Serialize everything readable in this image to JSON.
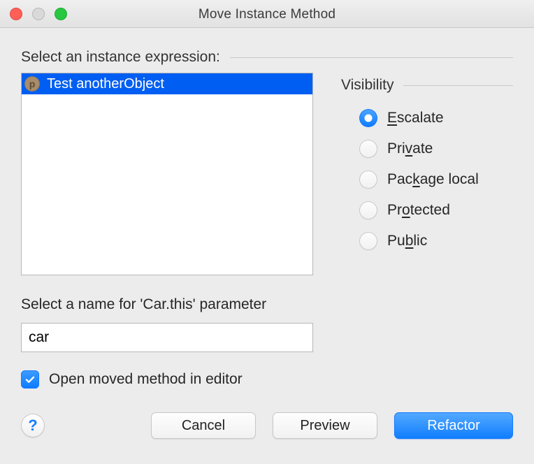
{
  "window": {
    "title": "Move Instance Method"
  },
  "instance_expression": {
    "label": "Select an instance expression:",
    "items": [
      {
        "badge": "p",
        "text": "Test anotherObject",
        "selected": true
      }
    ]
  },
  "visibility": {
    "label": "Visibility",
    "selected": 0,
    "options": [
      {
        "text": "Escalate",
        "mnemonic_index": 0
      },
      {
        "text": "Private",
        "mnemonic_index": 3
      },
      {
        "text": "Package local",
        "mnemonic_index": 3
      },
      {
        "text": "Protected",
        "mnemonic_index": 2
      },
      {
        "text": "Public",
        "mnemonic_index": 2
      }
    ]
  },
  "parameter_name": {
    "label": "Select a name for 'Car.this' parameter",
    "value": "car"
  },
  "open_in_editor": {
    "checked": true,
    "label": "Open moved method in editor"
  },
  "footer": {
    "help": "?",
    "cancel": "Cancel",
    "preview": "Preview",
    "refactor": "Refactor"
  }
}
